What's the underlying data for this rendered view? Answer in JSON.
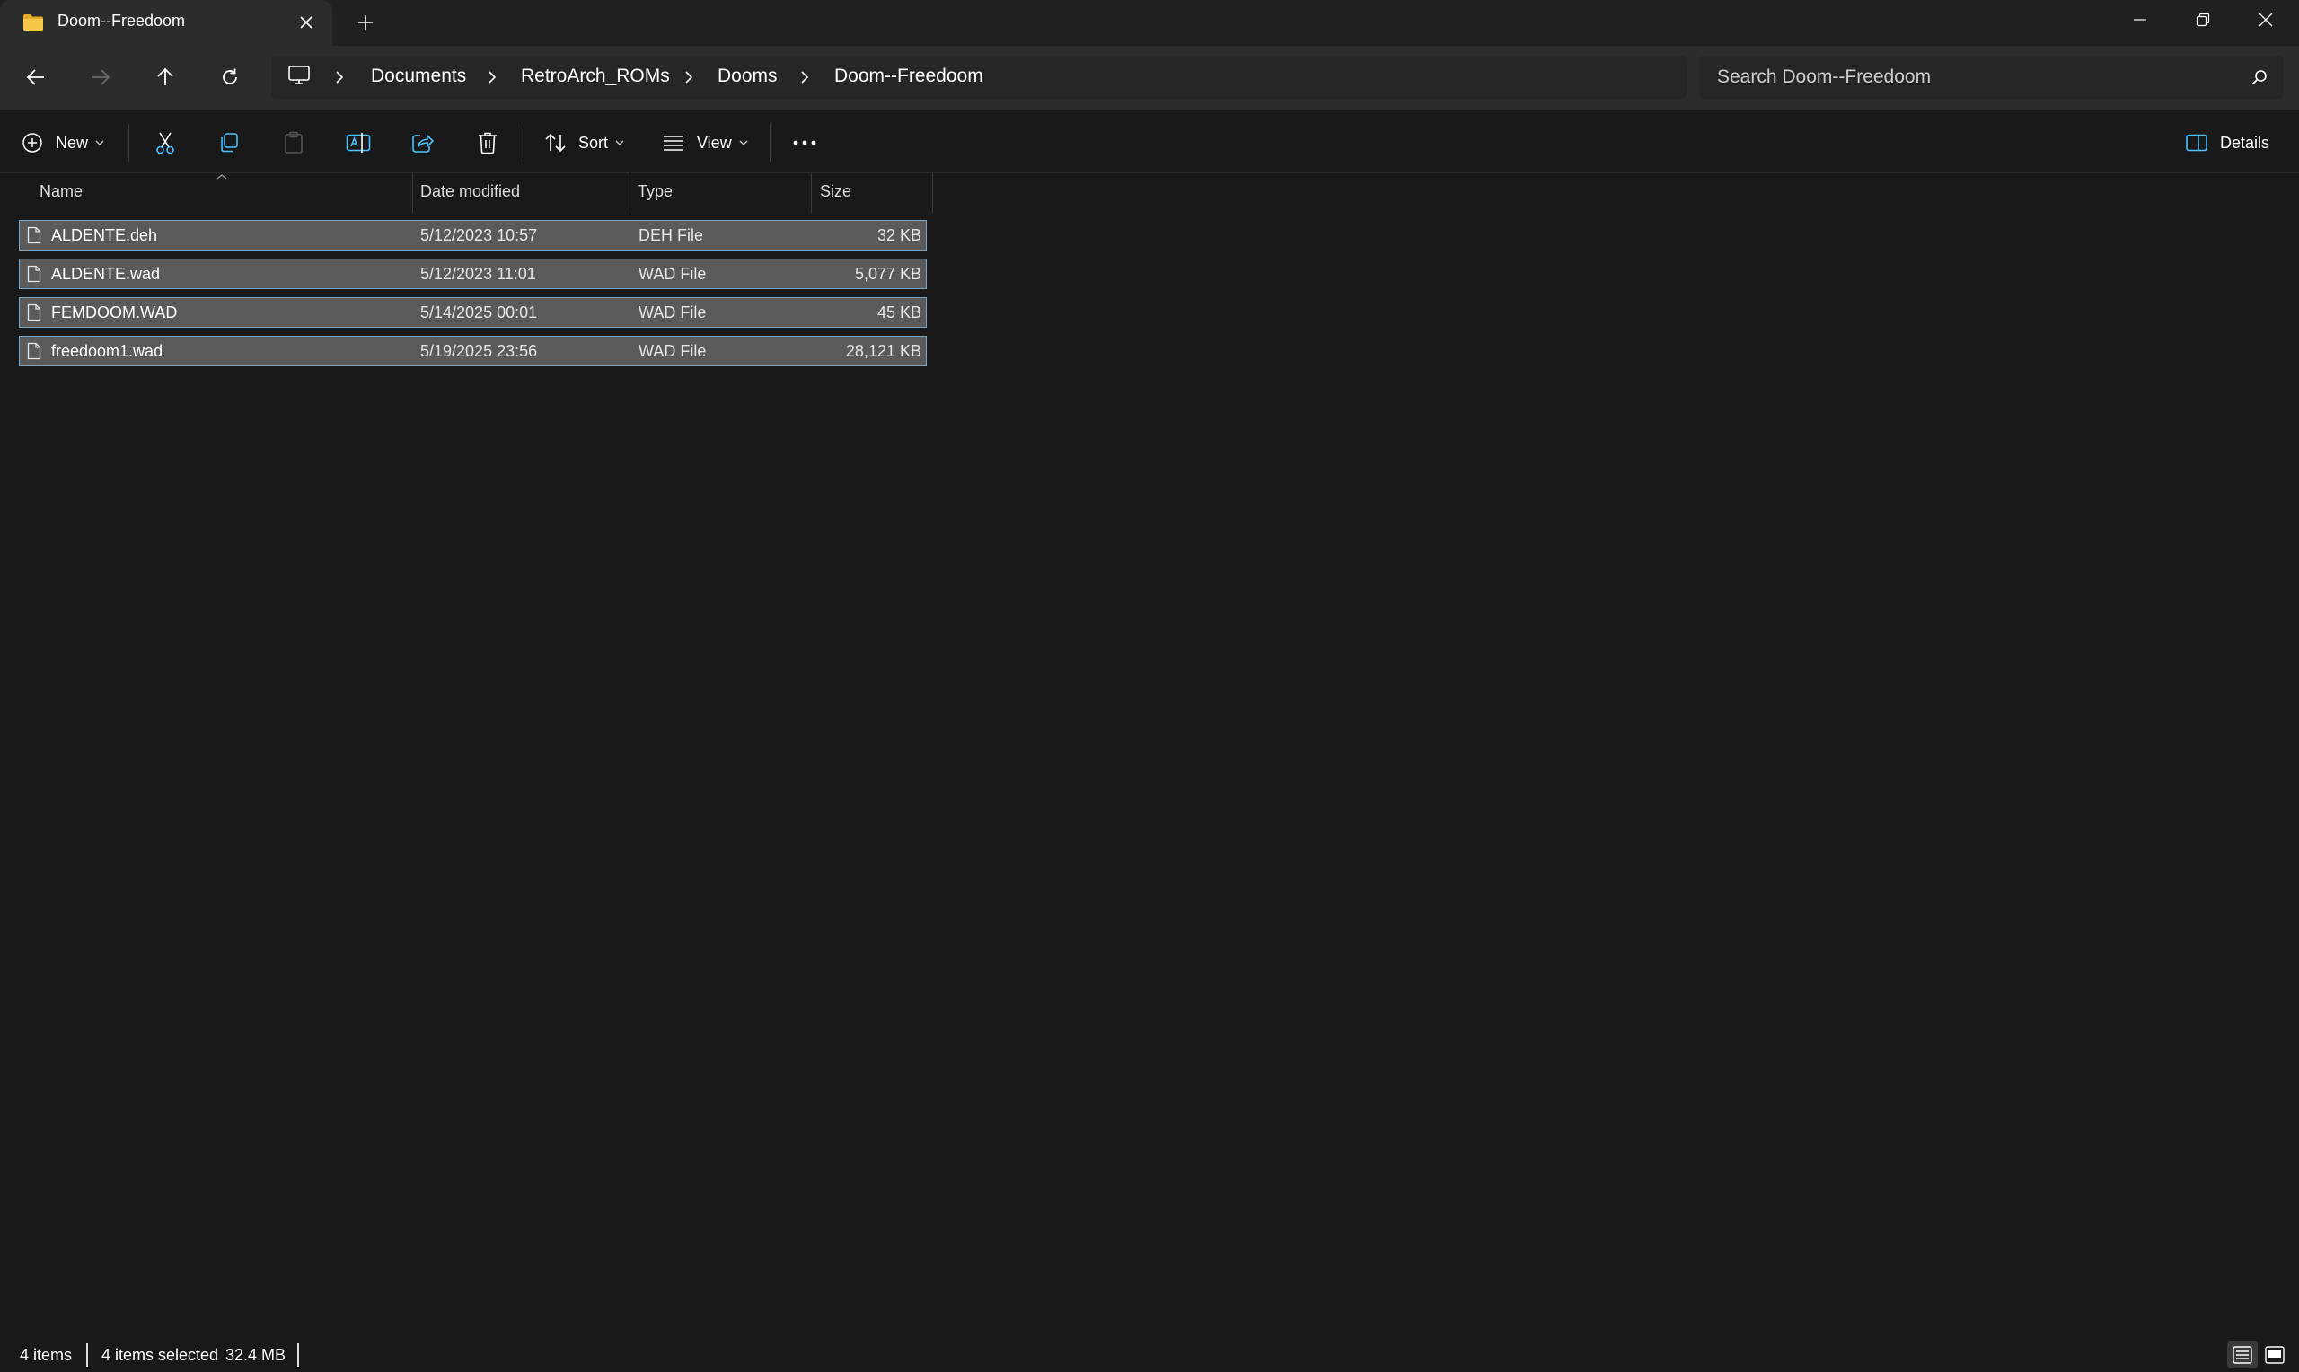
{
  "window": {
    "tab_title": "Doom--Freedoom",
    "icons": {
      "tab": "folder-icon",
      "close_tab": "close-icon",
      "new_tab": "plus-icon",
      "minimize": "minimize-icon",
      "restore": "restore-icon",
      "close": "close-icon"
    }
  },
  "nav": {
    "icons": [
      "back-arrow-icon",
      "forward-arrow-icon",
      "up-arrow-icon",
      "refresh-icon"
    ],
    "breadcrumb": [
      "Documents",
      "RetroArch_ROMs",
      "Dooms",
      "Doom--Freedoom"
    ],
    "search_placeholder": "Search Doom--Freedoom"
  },
  "toolbar": {
    "new_label": "New",
    "sort_label": "Sort",
    "view_label": "View",
    "details_label": "Details",
    "icons": [
      "cut-icon",
      "copy-icon",
      "paste-icon",
      "rename-icon",
      "share-icon",
      "delete-icon",
      "more-icon"
    ]
  },
  "columns": {
    "name": "Name",
    "date": "Date modified",
    "type": "Type",
    "size": "Size"
  },
  "files": [
    {
      "name": "ALDENTE.deh",
      "date": "5/12/2023 10:57",
      "type": "DEH File",
      "size": "32 KB"
    },
    {
      "name": "ALDENTE.wad",
      "date": "5/12/2023 11:01",
      "type": "WAD File",
      "size": "5,077 KB"
    },
    {
      "name": "FEMDOOM.WAD",
      "date": "5/14/2025 00:01",
      "type": "WAD File",
      "size": "45 KB"
    },
    {
      "name": "freedoom1.wad",
      "date": "5/19/2025 23:56",
      "type": "WAD File",
      "size": "28,121 KB"
    }
  ],
  "status": {
    "item_count": "4 items",
    "selected": "4 items selected",
    "selected_size": "32.4 MB"
  },
  "colors": {
    "window_bg": "#191919",
    "titlebar_bg": "#202020",
    "navbar_bg": "#2c2c2c",
    "selection_bg": "#5a5a5a",
    "selection_border": "#7aa6c8",
    "folder_yellow": "#f2c230",
    "accent_blue": "#4cc2ff"
  }
}
